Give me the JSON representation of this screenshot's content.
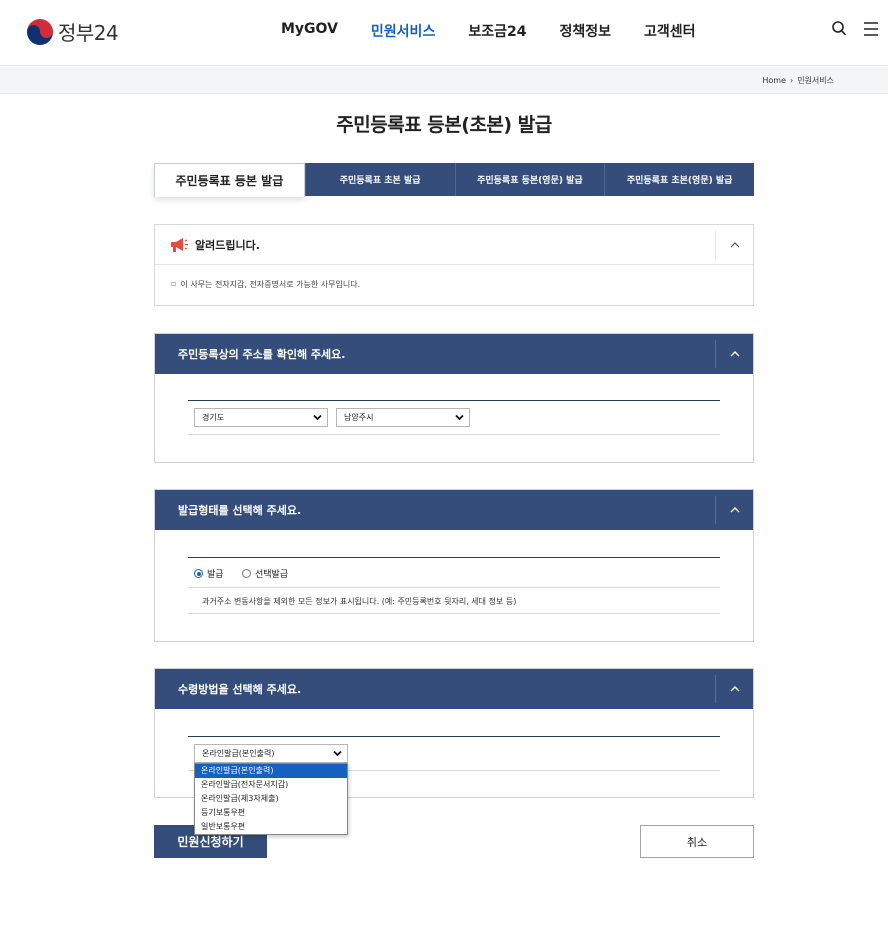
{
  "header": {
    "logo_text": "정부24",
    "nav": [
      "MyGOV",
      "민원서비스",
      "보조금24",
      "정책정보",
      "고객센터"
    ],
    "active_nav": "민원서비스"
  },
  "breadcrumb": {
    "home": "Home",
    "current": "민원서비스"
  },
  "page_title": "주민등록표 등본(초본) 발급",
  "tabs": [
    {
      "label": "주민등록표 등본 발급",
      "active": true
    },
    {
      "label": "주민등록표 초본 발급",
      "active": false
    },
    {
      "label": "주민등록표 등본(영문) 발급",
      "active": false
    },
    {
      "label": "주민등록표 초본(영문) 발급",
      "active": false
    }
  ],
  "notice": {
    "title": "알려드립니다.",
    "body": "이 사무는 전자지갑, 전자증명서로 가능한 사무입니다."
  },
  "address_section": {
    "title": "주민등록상의 주소를 확인해 주세요.",
    "province": "경기도",
    "city": "남양주시"
  },
  "issue_type_section": {
    "title": "발급형태를 선택해 주세요.",
    "options": [
      "발급",
      "선택발급"
    ],
    "selected": "발급",
    "description": "과거주소 변동사항을 제외한 모든 정보가 표시됩니다. (예: 주민등록번호 뒷자리, 세대 정보 등)"
  },
  "receive_section": {
    "title": "수령방법을 선택해 주세요.",
    "selected": "온라인발급(본인출력)",
    "options": [
      "온라인발급(본인출력)",
      "온라인발급(전자문서지갑)",
      "온라인발급(제3자제출)",
      "등기보통우편",
      "일반보통우편"
    ]
  },
  "buttons": {
    "submit": "민원신청하기",
    "cancel": "취소"
  },
  "colors": {
    "navy": "#344d7a",
    "active_nav": "#1560c1",
    "logo_red": "#cd2e3a",
    "logo_blue": "#0f2f6e"
  },
  "icons": {
    "search": "search-icon",
    "menu": "menu-icon",
    "notice": "megaphone-icon",
    "collapse": "chevron-up-icon",
    "dropdown": "chevron-down-icon"
  }
}
